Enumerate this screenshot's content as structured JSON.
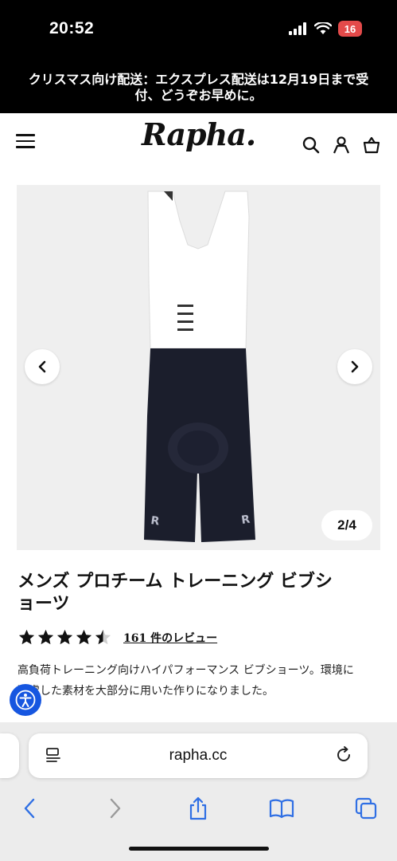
{
  "status_bar": {
    "time": "20:52",
    "battery": "16"
  },
  "announcement": {
    "line1": "クリスマス向け配送：エクスプレス配送は12月19日まで受",
    "line2": "付、どうぞお早めに。"
  },
  "header": {
    "logo": "Rapha."
  },
  "gallery": {
    "counter": "2/4"
  },
  "product": {
    "title_line1": "メンズ プロチーム トレーニング ビブシ",
    "title_line2": "ョーツ",
    "rating": 4.5,
    "reviews_label": "161 件のレビュー",
    "description_line1": "高負荷トレーニング向けハイパフォーマンス ビブショーツ。環境に",
    "description_line2": "配慮した素材を大部分に用いた作りになりました。"
  },
  "browser": {
    "url": "rapha.cc"
  },
  "colors": {
    "accent_blue": "#1656e0",
    "battery_red": "#e34a4a",
    "toolbar_blue": "#2f6fe4"
  },
  "icons": [
    "signal-icon",
    "wifi-icon",
    "menu-icon",
    "search-icon",
    "account-icon",
    "basket-icon",
    "chevron-left-icon",
    "chevron-right-icon",
    "accessibility-icon",
    "reader-icon",
    "reload-icon",
    "back-icon",
    "forward-icon",
    "share-icon",
    "bookmarks-icon",
    "tabs-icon"
  ]
}
